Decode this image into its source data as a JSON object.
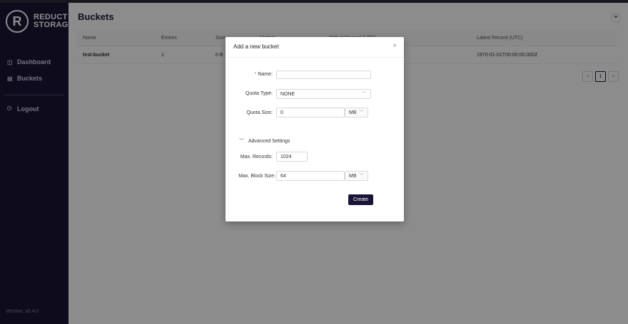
{
  "sidebar": {
    "logo_letter": "R",
    "logo_line1": "REDUCT",
    "logo_line2": "STORAGE",
    "items": [
      {
        "label": "Dashboard",
        "icon": "dashboard-icon"
      },
      {
        "label": "Buckets",
        "icon": "database-icon"
      },
      {
        "label": "Logout",
        "icon": "logout-icon"
      }
    ],
    "version": "Version: v0.4.0"
  },
  "main": {
    "title": "Buckets",
    "add_label": "+",
    "table": {
      "columns": [
        "Name",
        "Entries",
        "Size",
        "History",
        "Oldest Record (UTC)",
        "Latest Record (UTC)"
      ],
      "rows": [
        {
          "name": "test-bucket",
          "entries": "1",
          "size": "0 B",
          "history": "",
          "oldest": "",
          "latest": "1970-01-01T00:00:00.000Z"
        }
      ]
    },
    "pagination": {
      "prev": "<",
      "page": "1",
      "next": ">"
    }
  },
  "modal": {
    "title": "Add a new bucket",
    "close": "×",
    "name_label": "Name",
    "name_value": "",
    "quota_type_label": "Quota Type",
    "quota_type_value": "NONE",
    "quota_size_label": "Quota Size",
    "quota_size_value": "0",
    "quota_size_unit": "MB",
    "advanced_label": "Advanced Settings",
    "max_records_label": "Max. Records",
    "max_records_value": "1024",
    "max_block_label": "Max. Block Size",
    "max_block_value": "64",
    "max_block_unit": "MB",
    "create_label": "Create"
  },
  "colors": {
    "sidebar_bg": "#1a1536",
    "primary": "#1a1536",
    "required": "#ff4d4f"
  }
}
